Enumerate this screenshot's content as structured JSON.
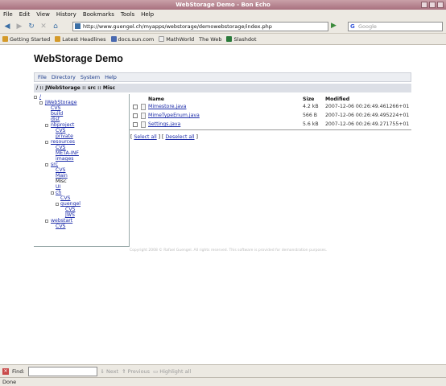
{
  "window": {
    "title": "WebStorage Demo - Bon Echo"
  },
  "menubar": {
    "items": [
      "File",
      "Edit",
      "View",
      "History",
      "Bookmarks",
      "Tools",
      "Help"
    ]
  },
  "navbar": {
    "url": "http://www.guengel.ch/myapps/webstorage/demowebstorage/index.php",
    "search_placeholder": "Google"
  },
  "bookmarks": [
    "Getting Started",
    "Latest Headlines",
    "docs.sun.com",
    "MathWorld",
    "The Web",
    "Slashdot"
  ],
  "page": {
    "title": "WebStorage Demo",
    "app_menu": [
      "File",
      "Directory",
      "System",
      "Help"
    ],
    "breadcrumb": "/ :: JWebStorage :: src :: Misc",
    "tree": [
      "/",
      "JWebStorage",
      "CVS",
      "build",
      "dist",
      "nbproject",
      "CVS",
      "private",
      "resources",
      "CVS",
      "META-INF",
      "images",
      "src",
      "CVS",
      "Main",
      "Misc",
      "UI",
      "ch",
      "CVS",
      "guengel",
      "CVS",
      "JWS",
      "webstart",
      "CVS"
    ],
    "file_headers": {
      "name": "Name",
      "size": "Size",
      "modified": "Modified"
    },
    "files": [
      {
        "name": "Mimestore.java",
        "size": "4.2 kB",
        "modified": "2007-12-06 00:26:49.461266+01"
      },
      {
        "name": "MimeTypeEnum.java",
        "size": "566 B",
        "modified": "2007-12-06 00:26:49.495224+01"
      },
      {
        "name": "Settings.java",
        "size": "5.6 kB",
        "modified": "2007-12-06 00:26:49.271755+01"
      }
    ],
    "select_all": "Select all",
    "deselect_all": "Deselect all",
    "footnote": "Copyright 2008 © Rafael Guengel. All rights reserved. This software is provided for demonstration purposes."
  },
  "findbar": {
    "label": "Find:",
    "next": "Next",
    "previous": "Previous",
    "highlight": "Highlight all"
  },
  "status": {
    "text": "Done"
  }
}
